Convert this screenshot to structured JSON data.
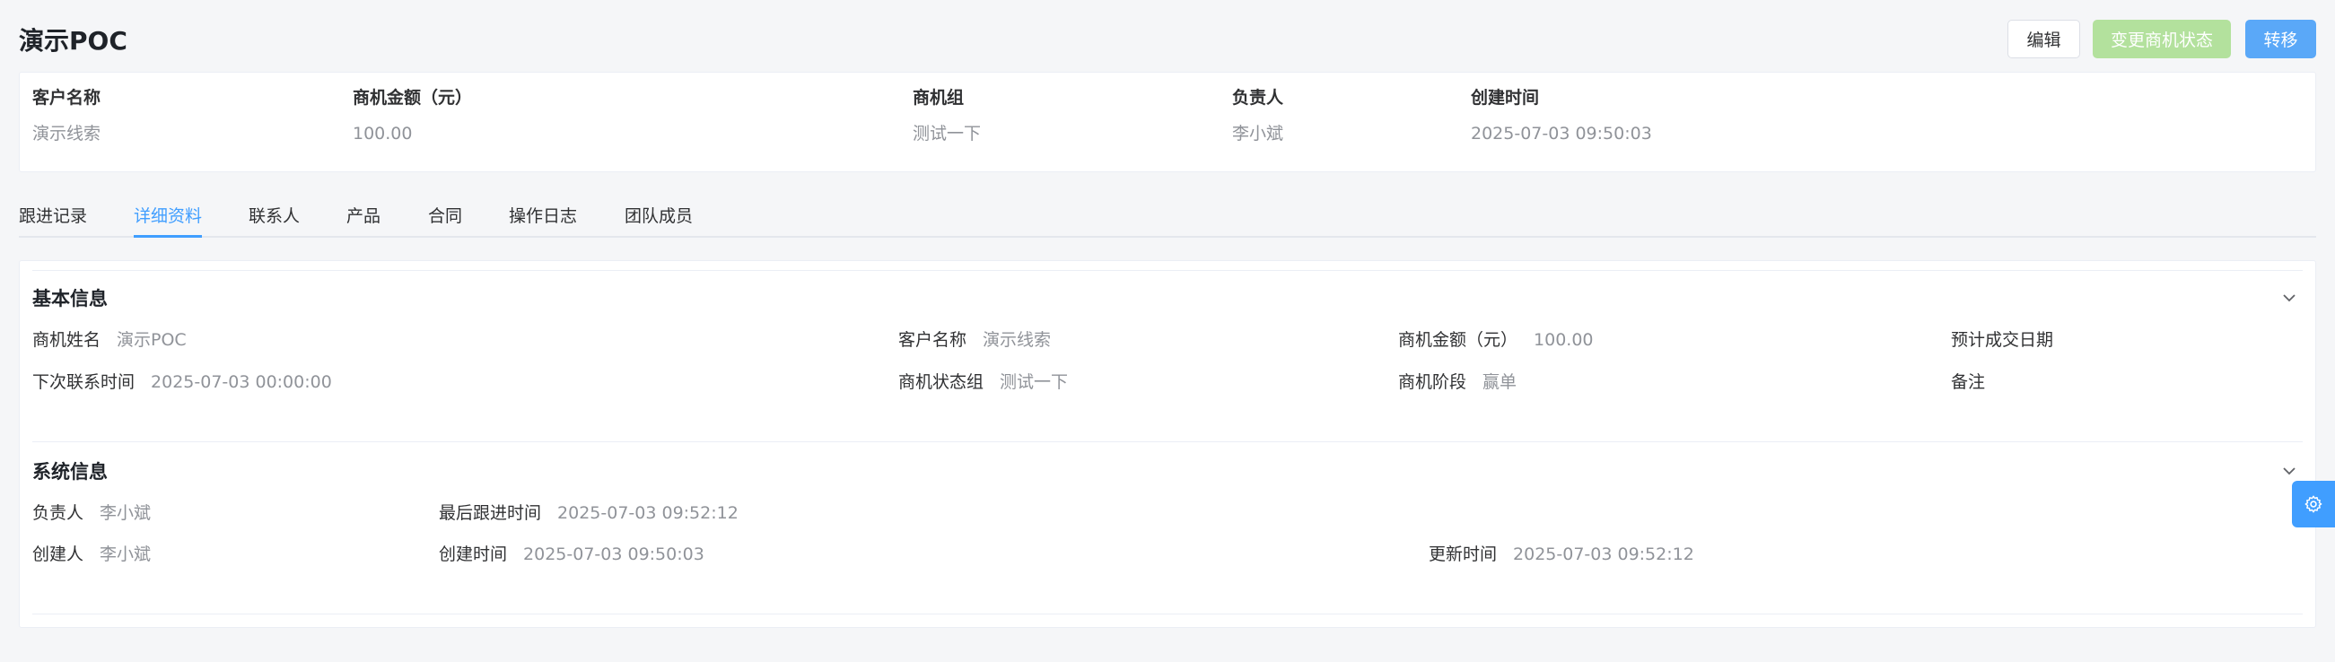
{
  "header": {
    "title": "演示POC",
    "buttons": {
      "edit": "编辑",
      "change_status": "变更商机状态",
      "transfer": "转移"
    }
  },
  "summary": {
    "customer": {
      "label": "客户名称",
      "value": "演示线索"
    },
    "amount": {
      "label": "商机金额（元）",
      "value": "100.00"
    },
    "group": {
      "label": "商机组",
      "value": "测试一下"
    },
    "owner": {
      "label": "负责人",
      "value": "李小斌"
    },
    "created": {
      "label": "创建时间",
      "value": "2025-07-03 09:50:03"
    }
  },
  "tabs": [
    "跟进记录",
    "详细资料",
    "联系人",
    "产品",
    "合同",
    "操作日志",
    "团队成员"
  ],
  "active_tab": "详细资料",
  "basic_info": {
    "title": "基本信息",
    "fields": {
      "name": {
        "label": "商机姓名",
        "value": "演示POC"
      },
      "customer": {
        "label": "客户名称",
        "value": "演示线索"
      },
      "amount": {
        "label": "商机金额（元）",
        "value": "100.00"
      },
      "expected_date": {
        "label": "预计成交日期",
        "value": ""
      },
      "next_contact": {
        "label": "下次联系时间",
        "value": "2025-07-03 00:00:00"
      },
      "status_group": {
        "label": "商机状态组",
        "value": "测试一下"
      },
      "stage": {
        "label": "商机阶段",
        "value": "赢单"
      },
      "remark": {
        "label": "备注",
        "value": ""
      }
    }
  },
  "system_info": {
    "title": "系统信息",
    "fields": {
      "owner": {
        "label": "负责人",
        "value": "李小斌"
      },
      "last_followup": {
        "label": "最后跟进时间",
        "value": "2025-07-03 09:52:12"
      },
      "creator": {
        "label": "创建人",
        "value": "李小斌"
      },
      "create_time": {
        "label": "创建时间",
        "value": "2025-07-03 09:50:03"
      },
      "update_time": {
        "label": "更新时间",
        "value": "2025-07-03 09:52:12"
      }
    }
  },
  "colors": {
    "primary": "#409eff",
    "success_light": "#b3e19d",
    "muted_text": "#909399"
  },
  "icons": {
    "collapse": "chevron-down-icon",
    "settings": "gear-icon"
  }
}
